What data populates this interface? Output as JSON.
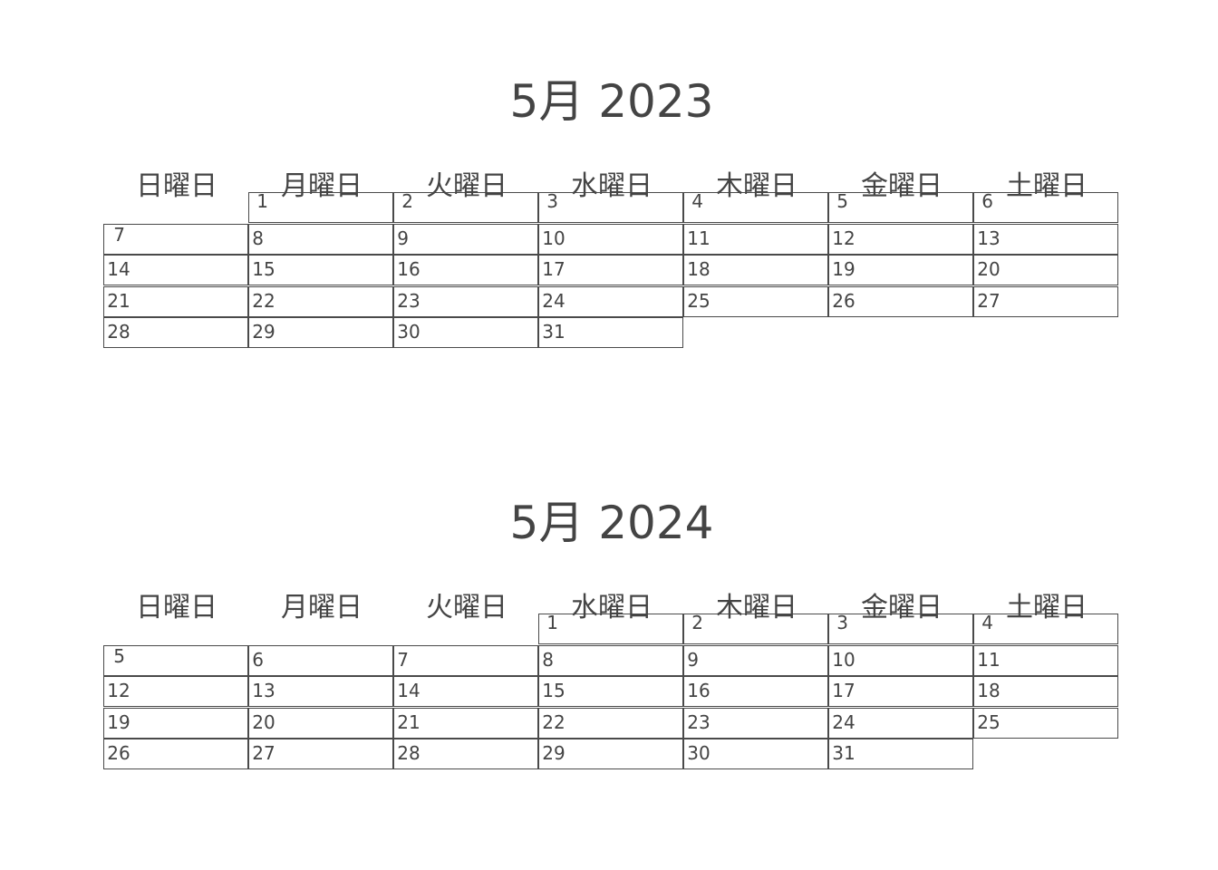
{
  "weekdays": [
    "日曜日",
    "月曜日",
    "火曜日",
    "水曜日",
    "木曜日",
    "金曜日",
    "土曜日"
  ],
  "calendars": [
    {
      "title": "5月 2023",
      "first_weekday": 1,
      "days_in_month": 31
    },
    {
      "title": "5月 2024",
      "first_weekday": 3,
      "days_in_month": 31
    }
  ]
}
